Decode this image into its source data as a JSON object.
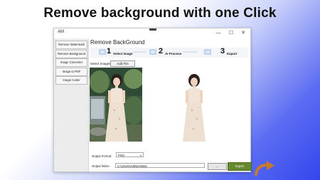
{
  "headline": "Remove background with one Click",
  "window": {
    "title": "AM",
    "controls": {
      "minimize": "—",
      "maximize": "☐",
      "close": "✕"
    }
  },
  "sidebar": {
    "items": [
      {
        "label": "Remove Watermark"
      },
      {
        "label": "Remove Background"
      },
      {
        "label": "Image Converter"
      },
      {
        "label": "Image to PDF"
      },
      {
        "label": "Image Cutter"
      }
    ]
  },
  "main": {
    "title": "Remove BackGround",
    "steps": [
      {
        "number": "1",
        "label": "Select Image"
      },
      {
        "number": "2",
        "label": "AI Process"
      },
      {
        "number": "3",
        "label": "Export"
      }
    ],
    "select_images_label": "Select Images:",
    "add_file_label": "Add File",
    "output_format_label": "Output Format:",
    "output_format_value": "PNG",
    "output_folder_label": "Output folder:",
    "output_folder_value": "C:\\Users\\yndi\\Desktop",
    "browse_label": "...",
    "export_label": "Export"
  },
  "colors": {
    "export_button": "#66892f",
    "accent_blue": "#3346ee",
    "arrow": "#c77a2b"
  }
}
